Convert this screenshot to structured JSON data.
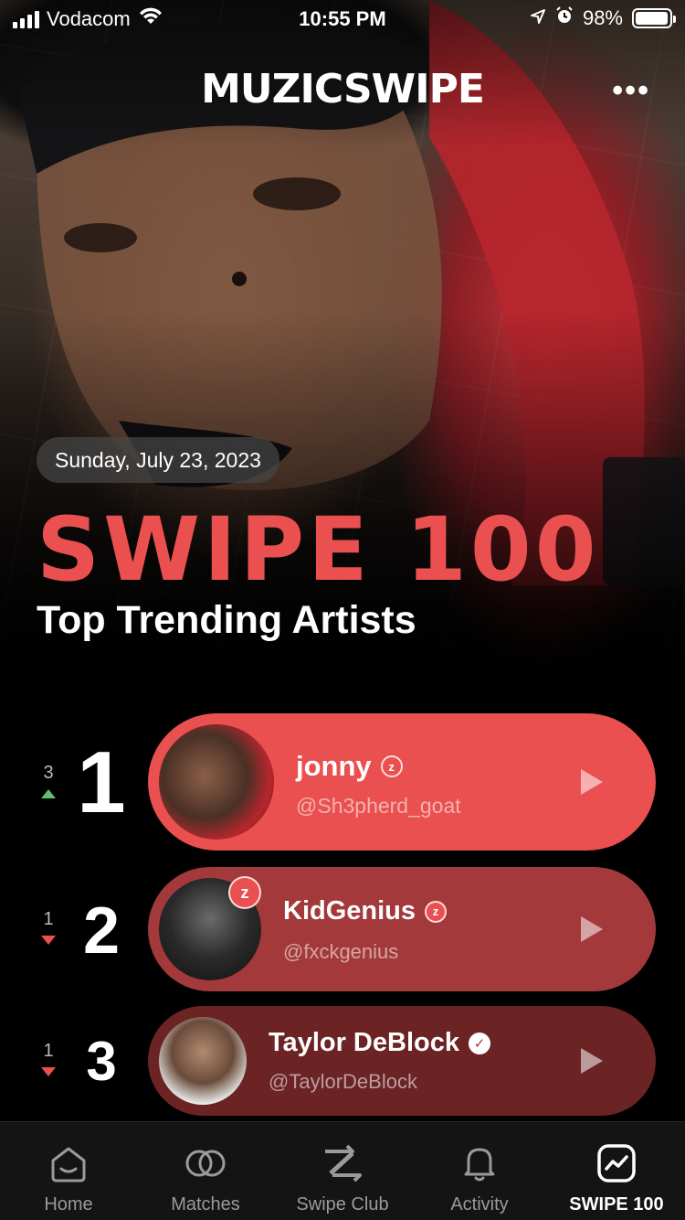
{
  "status_bar": {
    "carrier": "Vodacom",
    "time": "10:55 PM",
    "battery": "98%",
    "battery_level": 0.98
  },
  "header": {
    "logo": "MUZICSWIPE",
    "more_icon": "ellipsis-icon"
  },
  "hero": {
    "date": "Sunday, July 23, 2023",
    "title": "SWIPE 100",
    "subtitle": "Top Trending Artists"
  },
  "chart": [
    {
      "rank": "1",
      "change": "3",
      "direction": "up",
      "name": "jonny",
      "handle": "@Sh3pherd_goat",
      "badge": "z-badge",
      "card_color": "#e9504f"
    },
    {
      "rank": "2",
      "change": "1",
      "direction": "down",
      "name": "KidGenius",
      "handle": "@fxckgenius",
      "badge": "z-badge",
      "card_color": "#a3393a"
    },
    {
      "rank": "3",
      "change": "1",
      "direction": "down",
      "name": "Taylor DeBlock",
      "handle": "@TaylorDeBlock",
      "badge": "verified-badge",
      "card_color": "#6b2324"
    }
  ],
  "tabs": [
    {
      "label": "Home",
      "icon": "home-icon",
      "active": false
    },
    {
      "label": "Matches",
      "icon": "matches-icon",
      "active": false
    },
    {
      "label": "Swipe Club",
      "icon": "swipe-club-icon",
      "active": false
    },
    {
      "label": "Activity",
      "icon": "bell-icon",
      "active": false
    },
    {
      "label": "SWIPE 100",
      "icon": "chart-icon",
      "active": true
    }
  ]
}
